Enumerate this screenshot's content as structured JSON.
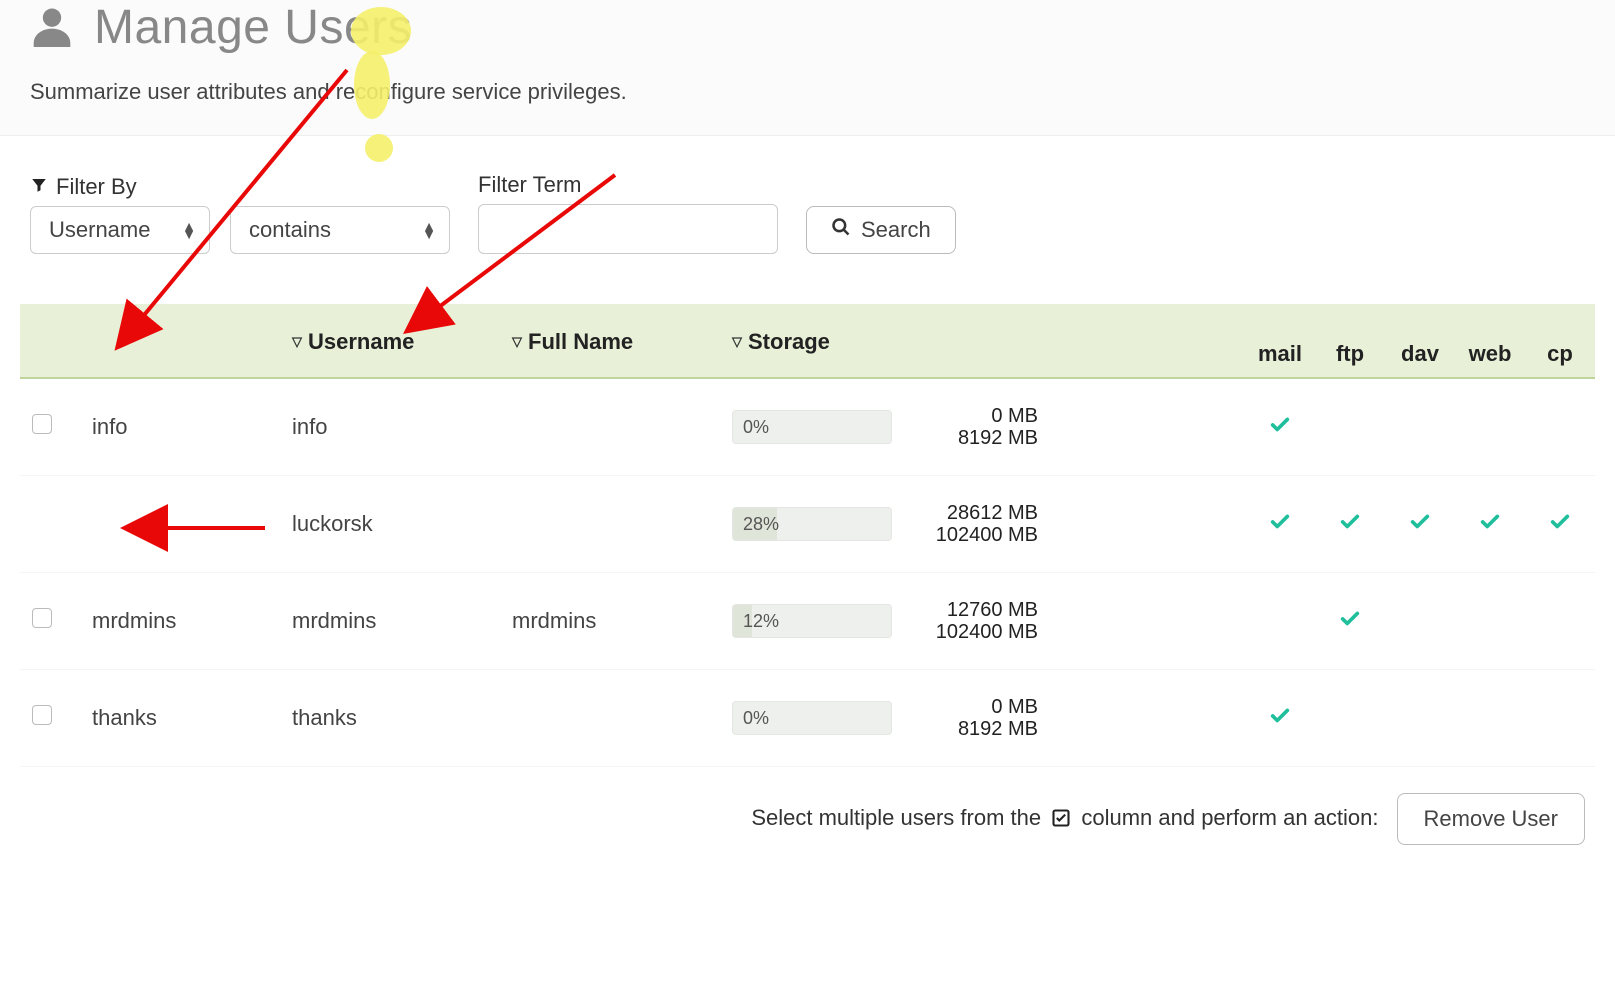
{
  "header": {
    "title": "Manage Users",
    "subtitle": "Summarize user attributes and reconfigure service privileges."
  },
  "filter": {
    "label": "Filter By",
    "field_options": [
      "Username"
    ],
    "field_selected": "Username",
    "op_options": [
      "contains"
    ],
    "op_selected": "contains",
    "term_label": "Filter Term",
    "term_value": "",
    "search_label": "Search"
  },
  "columns": {
    "checkbox": "",
    "username": "Username",
    "fullname": "Full Name",
    "storage": "Storage",
    "services": [
      "mail",
      "ftp",
      "dav",
      "web",
      "cp"
    ]
  },
  "rows": [
    {
      "checkbox_visible": true,
      "name": "info",
      "username": "info",
      "fullname": "",
      "storage": {
        "pct": "0%",
        "pct_num": 0,
        "used": "0 MB",
        "quota": "8192 MB"
      },
      "svc": {
        "mail": true,
        "ftp": false,
        "dav": false,
        "web": false,
        "cp": false
      }
    },
    {
      "checkbox_visible": false,
      "name": "",
      "username": "luckorsk",
      "fullname": "",
      "storage": {
        "pct": "28%",
        "pct_num": 28,
        "used": "28612 MB",
        "quota": "102400 MB"
      },
      "svc": {
        "mail": true,
        "ftp": true,
        "dav": true,
        "web": true,
        "cp": true
      }
    },
    {
      "checkbox_visible": true,
      "name": "mrdmins",
      "username": "mrdmins",
      "fullname": "mrdmins",
      "storage": {
        "pct": "12%",
        "pct_num": 12,
        "used": "12760 MB",
        "quota": "102400 MB"
      },
      "svc": {
        "mail": false,
        "ftp": true,
        "dav": false,
        "web": false,
        "cp": false
      }
    },
    {
      "checkbox_visible": true,
      "name": "thanks",
      "username": "thanks",
      "fullname": "",
      "storage": {
        "pct": "0%",
        "pct_num": 0,
        "used": "0 MB",
        "quota": "8192 MB"
      },
      "svc": {
        "mail": true,
        "ftp": false,
        "dav": false,
        "web": false,
        "cp": false
      }
    }
  ],
  "footer": {
    "hint_before": "Select multiple users from the ",
    "hint_after": " column and perform an action:",
    "remove_label": "Remove User"
  },
  "colors": {
    "accent_check": "#1fbf9c",
    "highlight_yellow": "#f4f06a",
    "arrow_red": "#e90808"
  }
}
